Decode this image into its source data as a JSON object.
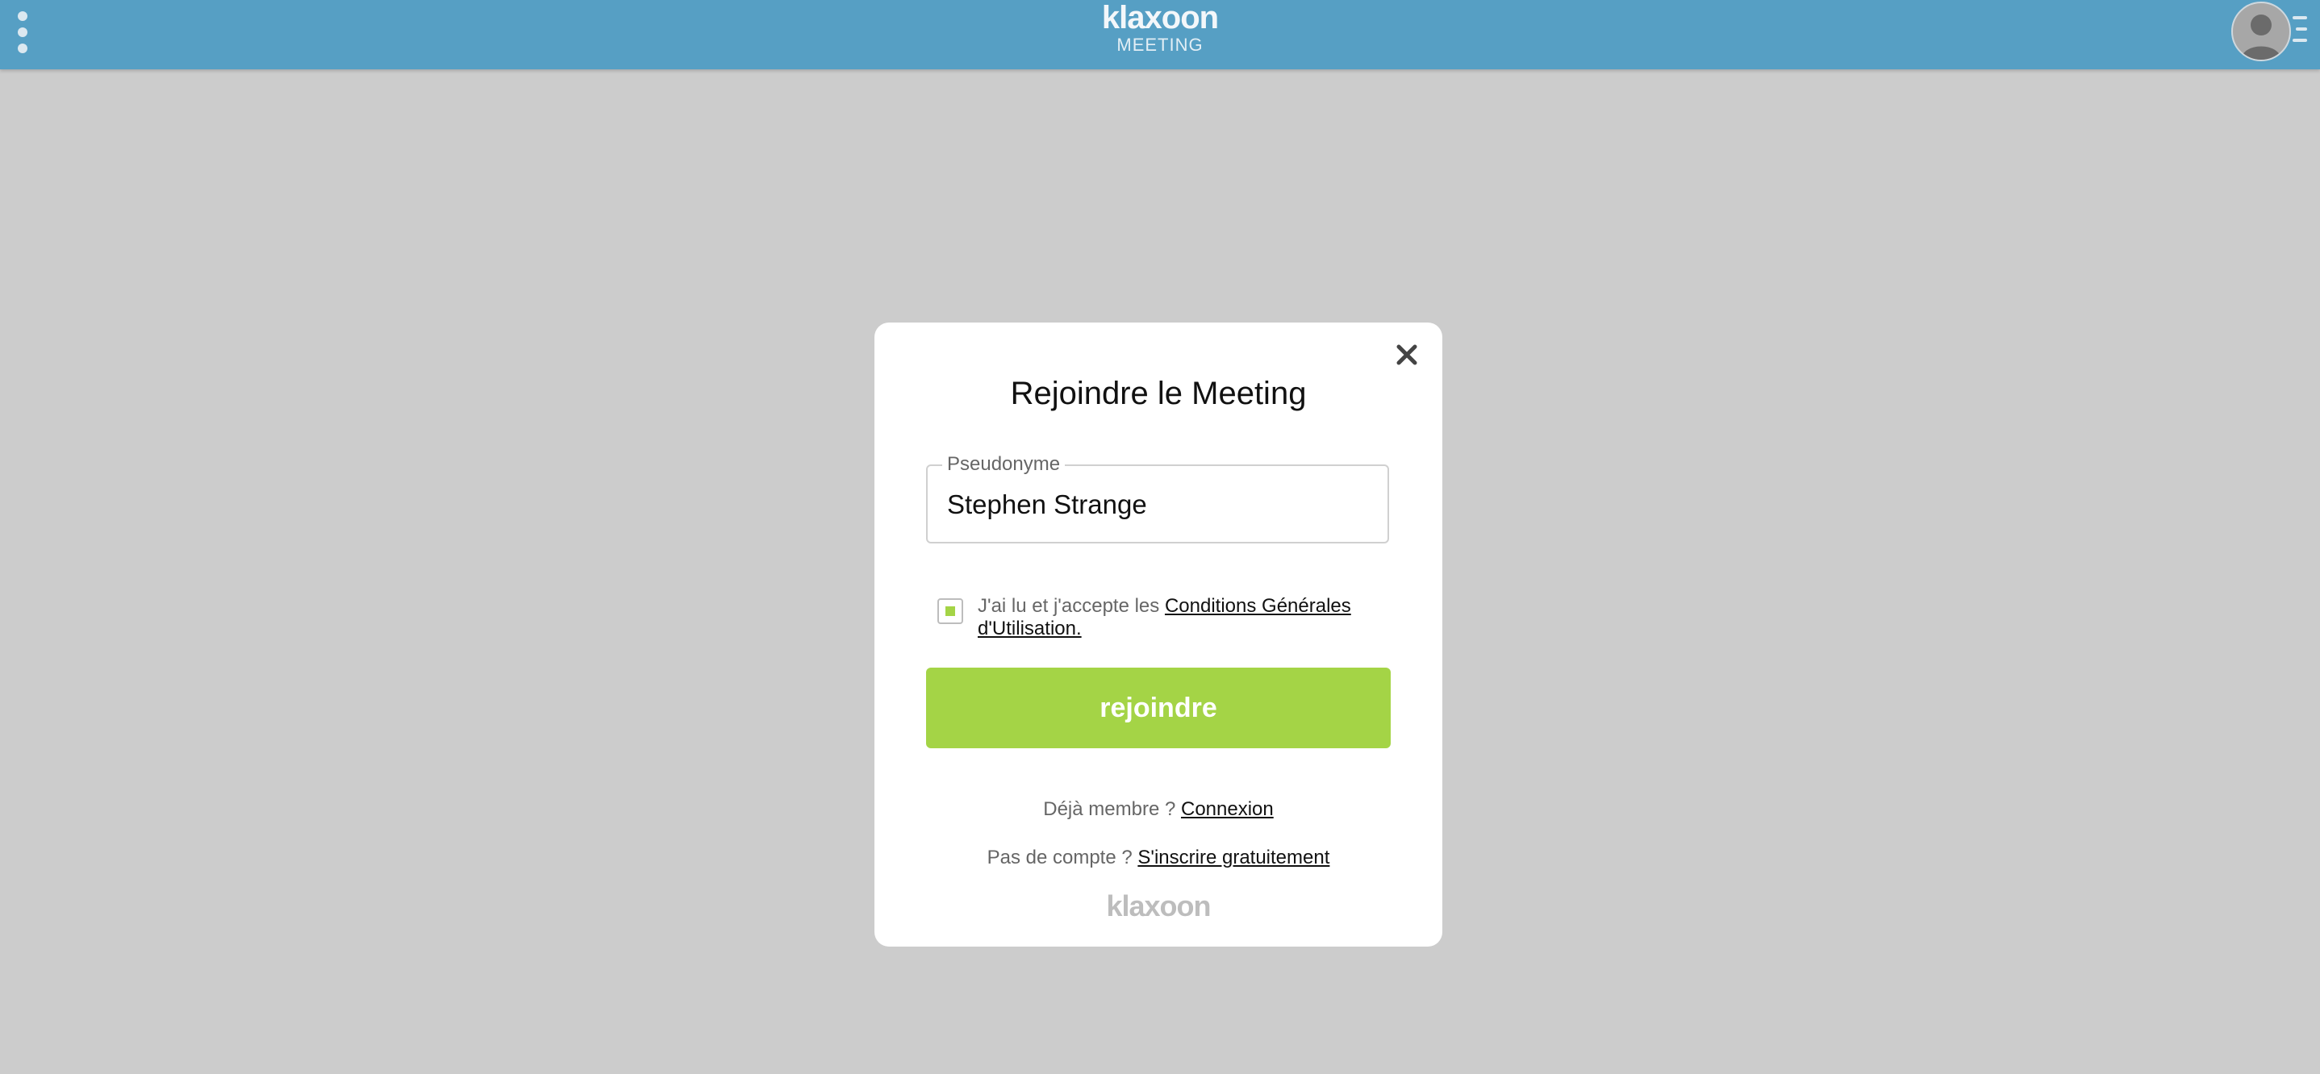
{
  "header": {
    "menu_icon": "kebab-menu-icon",
    "brand_logo": "klaxoon",
    "brand_subtitle": "MEETING",
    "avatar_icon": "user-avatar-icon",
    "avatar_menu_icon": "hamburger-menu-icon"
  },
  "modal": {
    "close_icon": "close-icon",
    "title": "Rejoindre le Meeting",
    "nickname_label": "Pseudonyme",
    "nickname_value": "Stephen Strange",
    "consent_prefix": "J'ai lu et j'accepte les ",
    "consent_link": "Conditions Générales d'Utilisation.",
    "consent_checked": true,
    "join_button": "rejoindre",
    "already_member_text": "Déjà membre ?",
    "login_link": "Connexion",
    "no_account_text": "Pas de compte ?",
    "signup_link": "S'inscrire gratuitement",
    "footer_logo": "klaxoon"
  },
  "colors": {
    "header_bg": "#569fc4",
    "page_bg": "#cccccc",
    "accent_green": "#a4d446",
    "modal_bg": "#ffffff"
  }
}
